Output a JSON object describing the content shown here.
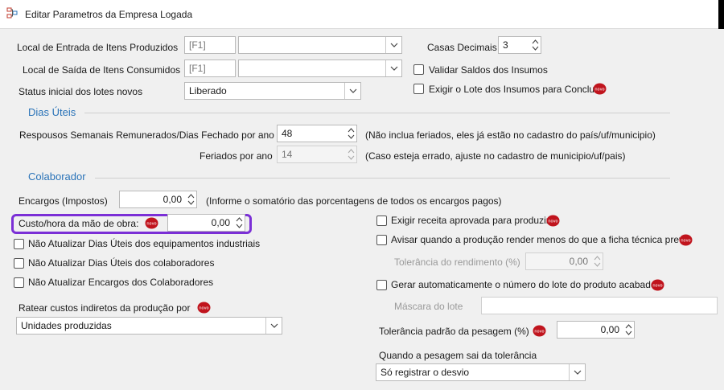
{
  "window": {
    "title": "Editar Parametros da Empresa Logada"
  },
  "colors": {
    "accent_section": "#2a73b8",
    "highlight": "#7b2fd6",
    "novo_badge": "#c0141d"
  },
  "top": {
    "local_entrada": {
      "label": "Local de Entrada de Itens Produzidos",
      "code": "[F1]",
      "value": ""
    },
    "local_saida": {
      "label": "Local de Saída de Itens Consumidos",
      "code": "[F1]",
      "value": ""
    },
    "status_lotes": {
      "label": "Status inicial dos lotes novos",
      "value": "Liberado"
    },
    "casas_decimais": {
      "label": "Casas Decimais",
      "value": "3"
    },
    "validar_saldos": {
      "label": "Validar Saldos dos Insumos",
      "checked": false
    },
    "exigir_lote": {
      "label": "Exigir o Lote dos Insumos para Concluir",
      "checked": false
    }
  },
  "dias_uteis": {
    "title": "Dias Úteis",
    "repousos": {
      "label": "Respousos Semanais Remunerados/Dias Fechado por ano",
      "value": "48",
      "hint": "(Não inclua feriados, eles já estão no cadastro do país/uf/municipio)"
    },
    "feriados": {
      "label": "Feriados por ano",
      "value": "14",
      "hint": "(Caso esteja errado, ajuste no cadastro de municipio/uf/pais)"
    }
  },
  "colaborador": {
    "title": "Colaborador",
    "encargos": {
      "label": "Encargos (Impostos)",
      "value": "0,00",
      "hint": "(Informe o somatório das porcentagens de todos os encargos pagos)"
    },
    "custo_hora": {
      "label": "Custo/hora da mão de obra:",
      "value": "0,00"
    },
    "nao_atualizar_equip": {
      "label": "Não Atualizar Dias Úteis dos equipamentos industriais",
      "checked": false
    },
    "nao_atualizar_colab": {
      "label": "Não Atualizar Dias Úteis dos colaboradores",
      "checked": false
    },
    "nao_atualizar_encargos": {
      "label": "Não Atualizar Encargos dos Colaboradores",
      "checked": false
    },
    "ratear": {
      "label": "Ratear custos indiretos da produção por",
      "value": "Unidades produzidas"
    }
  },
  "producao": {
    "exigir_receita": {
      "label": "Exigir receita aprovada para produzir",
      "checked": false
    },
    "avisar_rendimento": {
      "label": "Avisar quando a produção render menos do que a ficha técnica previa",
      "checked": false
    },
    "tolerancia_rendimento": {
      "label": "Tolerância do rendimento (%)",
      "value": "0,00"
    },
    "gerar_lote": {
      "label": "Gerar automaticamente o número do lote do produto acabado",
      "checked": false
    },
    "mascara_lote": {
      "label": "Máscara do lote",
      "value": ""
    },
    "tolerancia_pesagem": {
      "label": "Tolerância padrão da pesagem (%)",
      "value": "0,00"
    },
    "pesagem_fora": {
      "label": "Quando a pesagem sai da tolerância",
      "value": "Só registrar o desvio"
    }
  }
}
